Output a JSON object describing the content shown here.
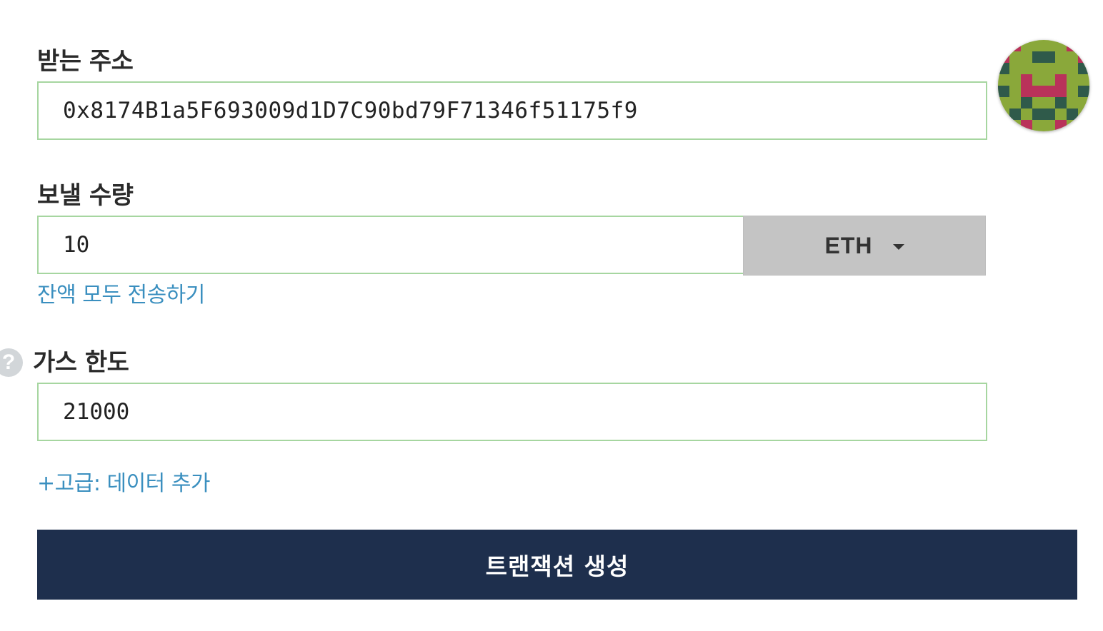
{
  "recipient": {
    "label": "받는 주소",
    "value": "0x8174B1a5F693009d1D7C90bd79F71346f51175f9"
  },
  "amount": {
    "label": "보낼 수량",
    "value": "10",
    "currency": "ETH",
    "send_all_link": "잔액 모두 전송하기"
  },
  "gas": {
    "label": "가스 한도",
    "value": "21000",
    "help_glyph": "?"
  },
  "advanced_link": "+고급: 데이터 추가",
  "submit_label": "트랜잭션 생성",
  "colors": {
    "input_border": "#a6d6a0",
    "link": "#3a8fbf",
    "button_bg": "#1e2f4d",
    "currency_bg": "#c4c4c4",
    "identicon_green": "#8aa83a",
    "identicon_pink": "#b9325a",
    "identicon_dark": "#2f5a4a"
  },
  "icons": {
    "identicon": "blockie-avatar-icon",
    "help": "question-circle-icon",
    "dropdown": "caret-down-icon"
  }
}
